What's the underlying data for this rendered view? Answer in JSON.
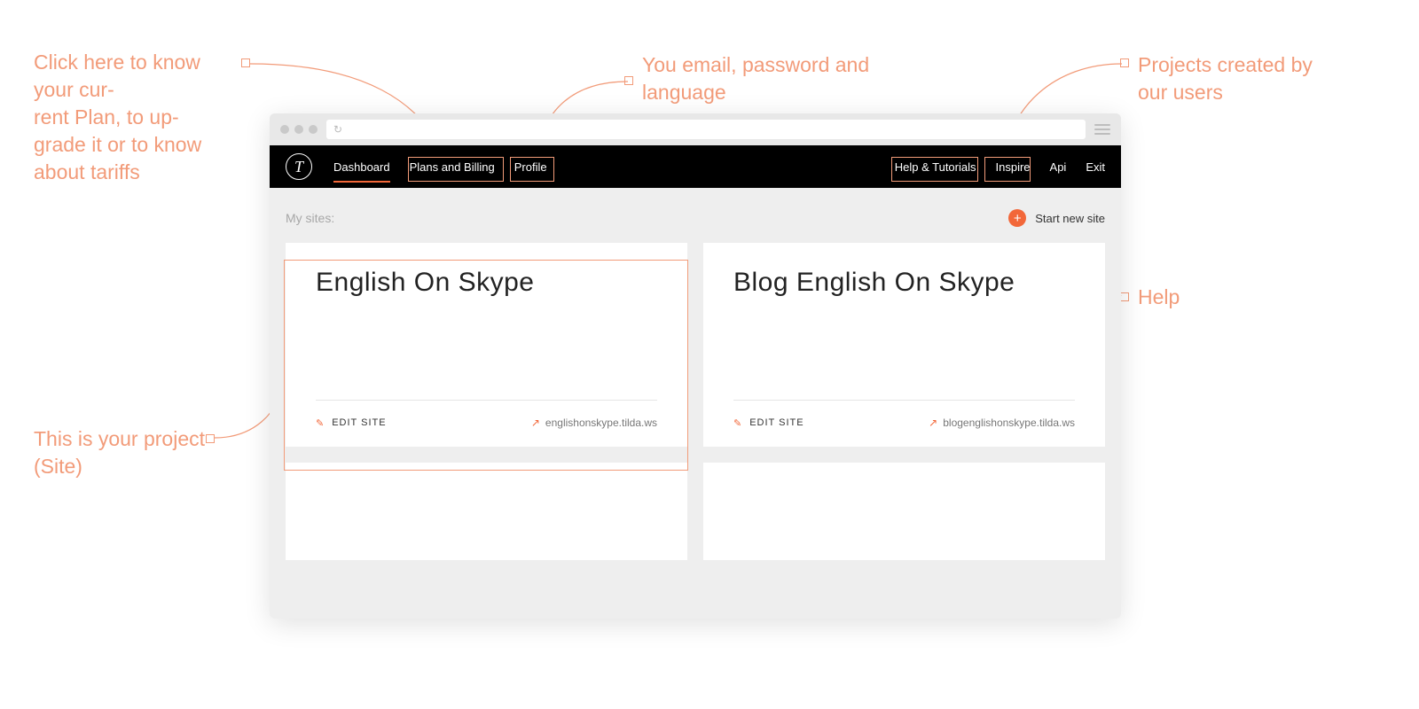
{
  "callouts": {
    "plans": "Click here to know your cur-\nrent Plan, to up-\ngrade it or to know about tariffs",
    "profile": "You email, password and language",
    "inspire": "Projects created by our users",
    "help": "Help",
    "project": "This is your project (Site)"
  },
  "nav": {
    "left": [
      "Dashboard",
      "Plans and Billing",
      "Profile"
    ],
    "right": [
      "Help & Tutorials",
      "Inspire",
      "Api",
      "Exit"
    ]
  },
  "content": {
    "mysites_label": "My sites:",
    "start_new_label": "Start new site"
  },
  "sites": [
    {
      "title": "English On Skype",
      "edit_label": "EDIT SITE",
      "url": "englishonskype.tilda.ws"
    },
    {
      "title": "Blog English On Skype",
      "edit_label": "EDIT SITE",
      "url": "blogenglishonskype.tilda.ws"
    }
  ]
}
